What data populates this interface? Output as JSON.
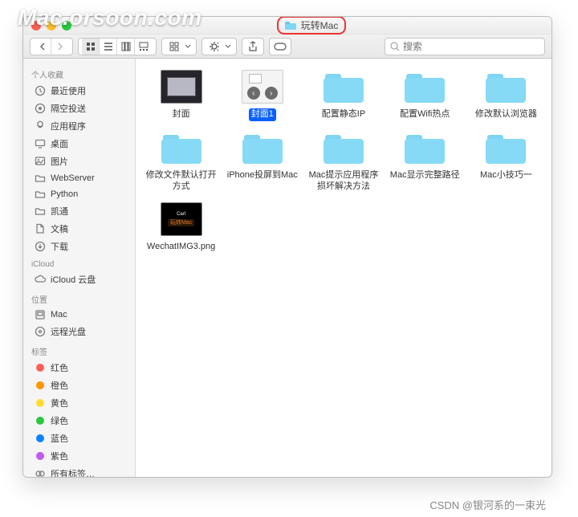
{
  "watermark": "Mac.orsoon.com",
  "footer": "CSDN @银河系的一束光",
  "window": {
    "title": "玩转Mac"
  },
  "search": {
    "placeholder": "搜索"
  },
  "sidebar": {
    "sections": [
      {
        "label": "个人收藏",
        "items": [
          {
            "icon": "clock",
            "label": "最近使用"
          },
          {
            "icon": "airdrop",
            "label": "隔空投送"
          },
          {
            "icon": "apps",
            "label": "应用程序"
          },
          {
            "icon": "desktop",
            "label": "桌面"
          },
          {
            "icon": "picture",
            "label": "图片"
          },
          {
            "icon": "folder",
            "label": "WebServer"
          },
          {
            "icon": "folder",
            "label": "Python"
          },
          {
            "icon": "folder",
            "label": "凯通"
          },
          {
            "icon": "doc",
            "label": "文稿"
          },
          {
            "icon": "download",
            "label": "下载"
          }
        ]
      },
      {
        "label": "iCloud",
        "items": [
          {
            "icon": "cloud",
            "label": "iCloud 云盘"
          }
        ]
      },
      {
        "label": "位置",
        "items": [
          {
            "icon": "disk",
            "label": "Mac"
          },
          {
            "icon": "disc",
            "label": "远程光盘"
          }
        ]
      },
      {
        "label": "标签",
        "items": [
          {
            "icon": "tag",
            "color": "#ff5f57",
            "label": "红色"
          },
          {
            "icon": "tag",
            "color": "#fe9500",
            "label": "橙色"
          },
          {
            "icon": "tag",
            "color": "#fedc30",
            "label": "黄色"
          },
          {
            "icon": "tag",
            "color": "#28c840",
            "label": "绿色"
          },
          {
            "icon": "tag",
            "color": "#0a84ff",
            "label": "蓝色"
          },
          {
            "icon": "tag",
            "color": "#bf5af2",
            "label": "紫色"
          },
          {
            "icon": "alltags",
            "label": "所有标签…"
          }
        ]
      }
    ]
  },
  "files": [
    {
      "type": "image-cover",
      "label": "封面",
      "selected": false
    },
    {
      "type": "image-sel",
      "label": "封面1",
      "selected": true
    },
    {
      "type": "folder",
      "label": "配置静态IP",
      "selected": false
    },
    {
      "type": "folder",
      "label": "配置Wifi热点",
      "selected": false
    },
    {
      "type": "folder",
      "label": "修改默认浏览器",
      "selected": false
    },
    {
      "type": "folder",
      "label": "修改文件默认打开方式",
      "selected": false
    },
    {
      "type": "folder",
      "label": "iPhone投屏到Mac",
      "selected": false
    },
    {
      "type": "folder",
      "label": "Mac提示应用程序损坏解决方法",
      "selected": false
    },
    {
      "type": "folder",
      "label": "Mac显示完整路径",
      "selected": false
    },
    {
      "type": "folder",
      "label": "Mac小技巧一",
      "selected": false
    },
    {
      "type": "image-wc",
      "label": "WechatIMG3.png",
      "selected": false
    }
  ]
}
